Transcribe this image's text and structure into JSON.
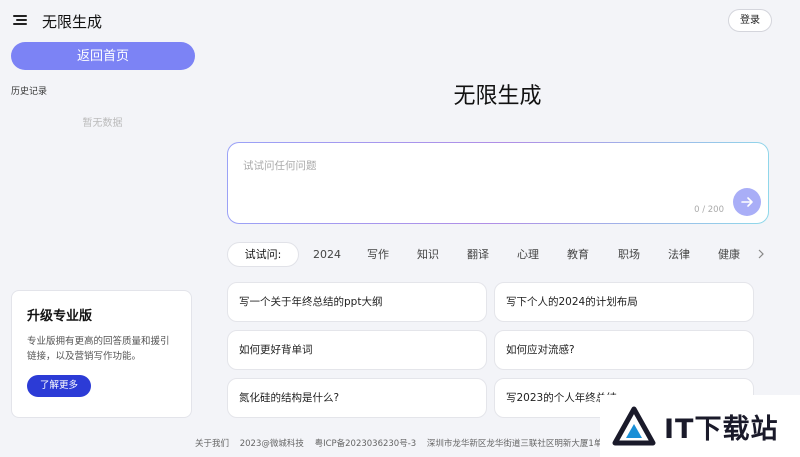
{
  "app": {
    "title": "无限生成"
  },
  "sidebar": {
    "home_button": "返回首页",
    "history_label": "历史记录",
    "empty_text": "暂无数据",
    "pro_card": {
      "title": "升级专业版",
      "description": "专业版拥有更高的回答质量和援引链接，以及营销写作功能。",
      "button": "了解更多"
    }
  },
  "header": {
    "login_button": "登录"
  },
  "main": {
    "title": "无限生成",
    "input": {
      "placeholder": "试试问任何问题",
      "counter": "0 / 200"
    },
    "tabs": {
      "lead": "试试问:",
      "items": [
        "2024",
        "写作",
        "知识",
        "翻译",
        "心理",
        "教育",
        "职场",
        "法律",
        "健康"
      ]
    },
    "suggestions": [
      "写一个关于年终总结的ppt大纲",
      "写下个人的2024的计划布局",
      "如何更好背单词",
      "如何应对流感?",
      "氮化硅的结构是什么?",
      "写2023的个人年终总结"
    ]
  },
  "footer": {
    "about": "关于我们",
    "copyright": "2023@微城科技",
    "icp": "粤ICP备2023036230号-3",
    "address": "深圳市龙华新区龙华街道三联社区明新大厦1单元514"
  },
  "watermark": {
    "text": "IT下载站"
  },
  "colors": {
    "primary": "#7c83f5",
    "pro_button": "#2c3bd6",
    "send_button": "#a9aef7"
  }
}
